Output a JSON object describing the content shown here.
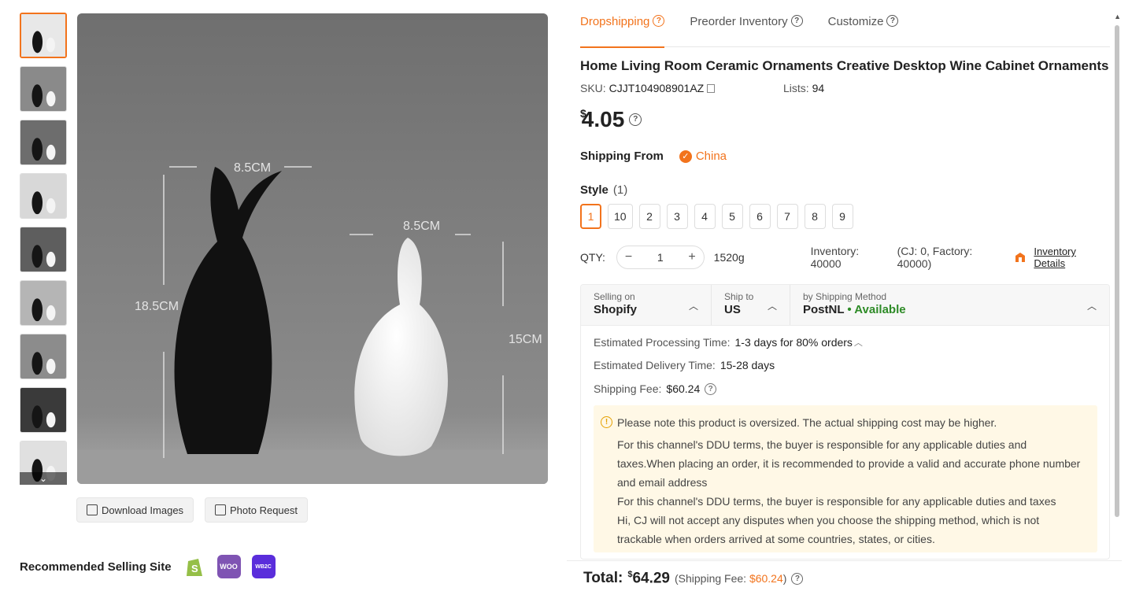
{
  "gallery": {
    "thumb_count": 9,
    "download_label": "Download Images",
    "photo_request_label": "Photo Request",
    "recommended_label": "Recommended Selling Site",
    "sites": [
      {
        "name": "shopify-icon",
        "color": "#95bf47"
      },
      {
        "name": "woocommerce-icon",
        "color": "#7f54b3",
        "text": "WOO"
      },
      {
        "name": "wix-icon",
        "color": "#5a2ddb",
        "text": "WB2C"
      }
    ],
    "image_labels": {
      "w1": "8.5CM",
      "w2": "8.5CM",
      "h1": "18.5CM",
      "h2": "15CM"
    }
  },
  "tabs": [
    {
      "label": "Dropshipping",
      "active": true
    },
    {
      "label": "Preorder Inventory",
      "active": false
    },
    {
      "label": "Customize",
      "active": false
    }
  ],
  "product": {
    "title": "Home Living Room Ceramic Ornaments Creative Desktop Wine Cabinet Ornaments",
    "sku_label": "SKU:",
    "sku": "CJJT104908901AZ",
    "lists_label": "Lists:",
    "lists": "94",
    "currency": "$",
    "price": "4.05",
    "shipping_from_label": "Shipping From",
    "origin": "China",
    "style_label": "Style",
    "style_count": "(1)",
    "styles": [
      "1",
      "10",
      "2",
      "3",
      "4",
      "5",
      "6",
      "7",
      "8",
      "9"
    ],
    "selected_style": "1",
    "qty_label": "QTY:",
    "qty": "1",
    "weight": "1520g",
    "inventory": "Inventory: 40000",
    "inventory_breakdown": "(CJ: 0, Factory: 40000)",
    "inventory_details": "Inventory Details"
  },
  "shipping": {
    "selling_on_label": "Selling on",
    "selling_on": "Shopify",
    "ship_to_label": "Ship to",
    "ship_to": "US",
    "method_label": "by Shipping Method",
    "method": "PostNL",
    "availability": "• Available",
    "processing_label": "Estimated Processing Time:",
    "processing": "1-3 days for 80% orders",
    "delivery_label": "Estimated Delivery Time:",
    "delivery": "15-28 days",
    "fee_label": "Shipping Fee:",
    "fee": "$60.24",
    "notes": [
      "Please note this product is oversized. The actual shipping cost may be higher.",
      "For this channel's DDU terms, the buyer is responsible for any applicable duties and taxes.When placing an order, it is recommended to provide a valid and accurate phone number and email address",
      "For this channel's DDU terms, the buyer is responsible for any applicable duties and taxes",
      "Hi, CJ will not accept any disputes when you choose the shipping method, which is not trackable when orders arrived at some countries, states, or cities."
    ]
  },
  "total": {
    "label": "Total:",
    "currency": "$",
    "amount": "64.29",
    "fee_prefix": "(Shipping Fee:",
    "fee": "$60.24",
    "fee_suffix": ")"
  },
  "colors": {
    "accent": "#f2731c",
    "available": "#2e8b27",
    "note_bg": "#fff8e6"
  }
}
